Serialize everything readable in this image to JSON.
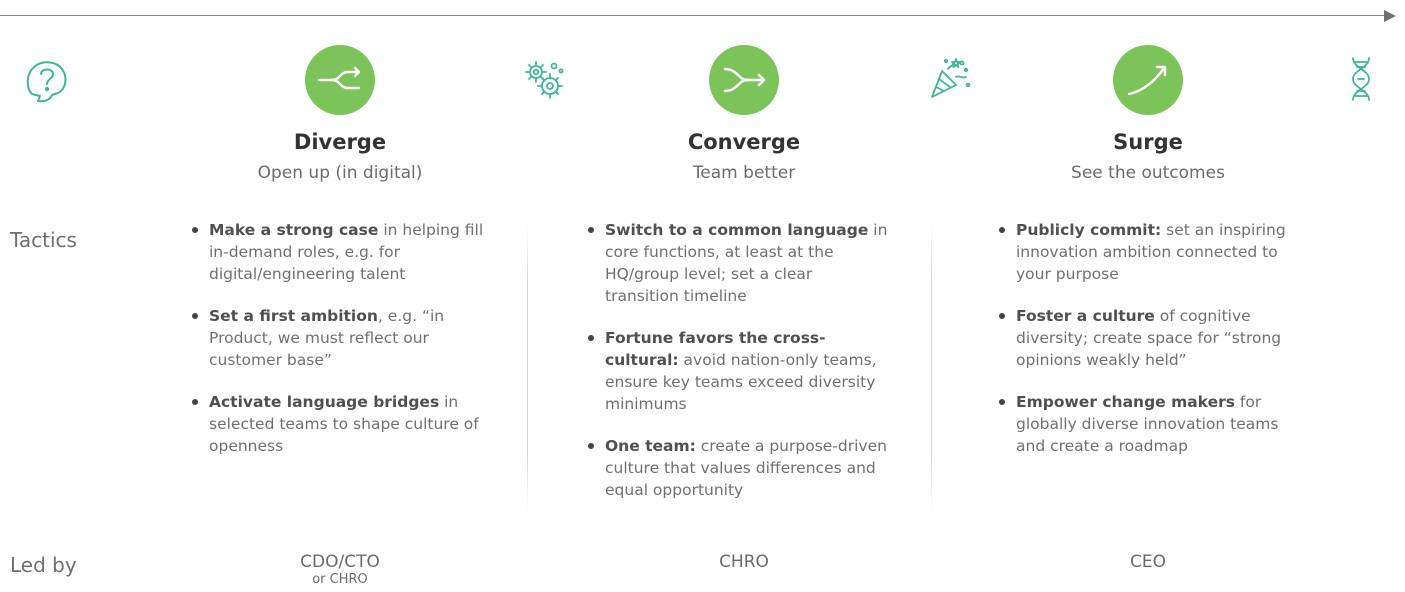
{
  "stages": [
    {
      "title": "Diverge",
      "subtitle": "Open up (in digital)",
      "icon": "diverge-arrow-icon"
    },
    {
      "title": "Converge",
      "subtitle": "Team better",
      "icon": "converge-arrow-icon"
    },
    {
      "title": "Surge",
      "subtitle": "See the outcomes",
      "icon": "surge-arrow-icon"
    }
  ],
  "decorative_icons": [
    "question-head-icon",
    "gears-icon",
    "party-popper-icon",
    "dna-icon"
  ],
  "row_labels": {
    "tactics": "Tactics",
    "led_by": "Led by"
  },
  "tactics": {
    "diverge": [
      {
        "bold": "Make a strong case",
        "text": " in helping fill in-demand roles, e.g. for digital/engineering talent"
      },
      {
        "bold": "Set a first ambition",
        "text": ", e.g. “in Product, we must reflect our customer base”"
      },
      {
        "bold": "Activate language bridges",
        "text": " in selected teams to shape culture of openness"
      }
    ],
    "converge": [
      {
        "bold": "Switch to a common language",
        "text": " in core functions, at least at the HQ/group level; set a clear transition timeline"
      },
      {
        "bold": "Fortune favors the cross-cultural:",
        "text": " avoid nation-only teams, ensure key teams exceed diversity minimums"
      },
      {
        "bold": "One team:",
        "text": " create a purpose-driven culture that values differences and equal opportunity"
      }
    ],
    "surge": [
      {
        "bold": "Publicly commit:",
        "text": " set an inspiring innovation ambition connected to your purpose"
      },
      {
        "bold": "Foster a culture",
        "text": " of cognitive diversity; create space for “strong opinions weakly held”"
      },
      {
        "bold": "Empower change makers",
        "text": " for globally diverse innovation teams and create a roadmap"
      }
    ]
  },
  "led_by": [
    {
      "primary": "CDO/CTO",
      "secondary": "or CHRO"
    },
    {
      "primary": "CHRO",
      "secondary": ""
    },
    {
      "primary": "CEO",
      "secondary": ""
    }
  ],
  "colors": {
    "accent_green": "#7cc35a",
    "icon_teal": "#3fb59a"
  }
}
